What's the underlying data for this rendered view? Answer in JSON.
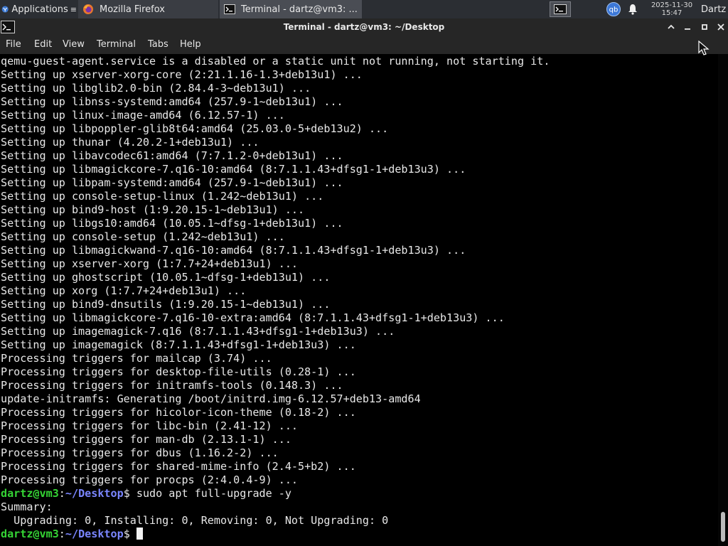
{
  "panel": {
    "applications_label": "Applications",
    "tasks": [
      {
        "label": "Mozilla Firefox",
        "icon": "firefox-icon"
      },
      {
        "label": "Terminal - dartz@vm3: ...",
        "icon": "terminal-icon"
      }
    ],
    "qbittorrent_label": "qb",
    "clock_date": "2025-11-30",
    "clock_time": "15:47",
    "user": "Dartz"
  },
  "window": {
    "title": "Terminal - dartz@vm3: ~/Desktop",
    "menu": [
      "File",
      "Edit",
      "View",
      "Terminal",
      "Tabs",
      "Help"
    ]
  },
  "colors": {
    "prompt_user": "#35d435",
    "prompt_path": "#7a86ff",
    "terminal_bg": "#000000",
    "terminal_fg": "#e8e8e8"
  },
  "terminal": {
    "lines": [
      "qemu-guest-agent.service is a disabled or a static unit not running, not starting it.",
      "Setting up xserver-xorg-core (2:21.1.16-1.3+deb13u1) ...",
      "Setting up libglib2.0-bin (2.84.4-3~deb13u1) ...",
      "Setting up libnss-systemd:amd64 (257.9-1~deb13u1) ...",
      "Setting up linux-image-amd64 (6.12.57-1) ...",
      "Setting up libpoppler-glib8t64:amd64 (25.03.0-5+deb13u2) ...",
      "Setting up thunar (4.20.2-1+deb13u1) ...",
      "Setting up libavcodec61:amd64 (7:7.1.2-0+deb13u1) ...",
      "Setting up libmagickcore-7.q16-10:amd64 (8:7.1.1.43+dfsg1-1+deb13u3) ...",
      "Setting up libpam-systemd:amd64 (257.9-1~deb13u1) ...",
      "Setting up console-setup-linux (1.242~deb13u1) ...",
      "Setting up bind9-host (1:9.20.15-1~deb13u1) ...",
      "Setting up libgs10:amd64 (10.05.1~dfsg-1+deb13u1) ...",
      "Setting up console-setup (1.242~deb13u1) ...",
      "Setting up libmagickwand-7.q16-10:amd64 (8:7.1.1.43+dfsg1-1+deb13u3) ...",
      "Setting up xserver-xorg (1:7.7+24+deb13u1) ...",
      "Setting up ghostscript (10.05.1~dfsg-1+deb13u1) ...",
      "Setting up xorg (1:7.7+24+deb13u1) ...",
      "Setting up bind9-dnsutils (1:9.20.15-1~deb13u1) ...",
      "Setting up libmagickcore-7.q16-10-extra:amd64 (8:7.1.1.43+dfsg1-1+deb13u3) ...",
      "Setting up imagemagick-7.q16 (8:7.1.1.43+dfsg1-1+deb13u3) ...",
      "Setting up imagemagick (8:7.1.1.43+dfsg1-1+deb13u3) ...",
      "Processing triggers for mailcap (3.74) ...",
      "Processing triggers for desktop-file-utils (0.28-1) ...",
      "Processing triggers for initramfs-tools (0.148.3) ...",
      "update-initramfs: Generating /boot/initrd.img-6.12.57+deb13-amd64",
      "Processing triggers for hicolor-icon-theme (0.18-2) ...",
      "Processing triggers for libc-bin (2.41-12) ...",
      "Processing triggers for man-db (2.13.1-1) ...",
      "Processing triggers for dbus (1.16.2-2) ...",
      "Processing triggers for shared-mime-info (2.4-5+b2) ...",
      "Processing triggers for procps (2:4.0.4-9) ..."
    ],
    "prompt_user": "dartz@vm3",
    "prompt_sep": ":",
    "prompt_path": "~/Desktop",
    "prompt_sym": "$",
    "command": " sudo apt full-upgrade -y",
    "output_lines": [
      "Summary:",
      "  Upgrading: 0, Installing: 0, Removing: 0, Not Upgrading: 0"
    ]
  }
}
